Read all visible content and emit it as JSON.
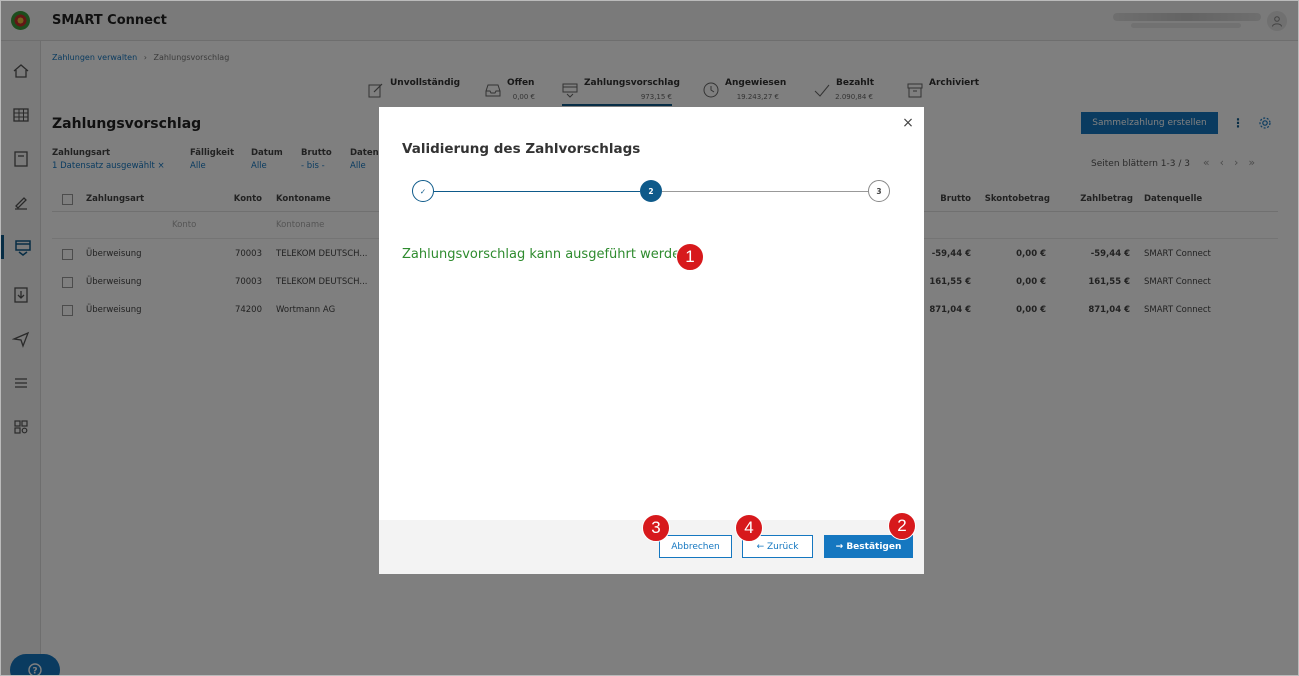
{
  "app": {
    "title": "SMART Connect"
  },
  "breadcrumb": {
    "root": "Zahlungen verwalten",
    "sep": "›",
    "current": "Zahlungsvorschlag"
  },
  "status_tabs": [
    {
      "label": "Unvollständig",
      "amount": ""
    },
    {
      "label": "Offen",
      "amount": "0,00 €"
    },
    {
      "label": "Zahlungsvorschlag",
      "amount": "973,15 €"
    },
    {
      "label": "Angewiesen",
      "amount": "19.243,27 €"
    },
    {
      "label": "Bezahlt",
      "amount": "2.090,84 €"
    },
    {
      "label": "Archiviert",
      "amount": ""
    }
  ],
  "page": {
    "title": "Zahlungsvorschlag",
    "primary_button": "Sammelzahlung erstellen",
    "paging_label": "Seiten blättern 1-3 / 3"
  },
  "filters": [
    {
      "label": "Zahlungsart",
      "value": "1 Datensatz ausgewählt ×"
    },
    {
      "label": "Fälligkeit",
      "value": "Alle"
    },
    {
      "label": "Datum",
      "value": "Alle"
    },
    {
      "label": "Brutto",
      "value": "- bis -"
    },
    {
      "label": "Datenq",
      "value": "Alle"
    }
  ],
  "table": {
    "headers": {
      "type": "Zahlungsart",
      "account": "Konto",
      "account_name": "Kontoname",
      "gross": "Brutto",
      "discount": "Skontobetrag",
      "payment": "Zahlbetrag",
      "source": "Datenquelle"
    },
    "filter_placeholders": {
      "account": "Konto",
      "account_name": "Kontoname"
    },
    "rows": [
      {
        "type": "Überweisung",
        "account": "70003",
        "account_name": "TELEKOM DEUTSCH...",
        "gross": "-59,44 €",
        "discount": "0,00 €",
        "payment": "-59,44 €",
        "source": "SMART Connect"
      },
      {
        "type": "Überweisung",
        "account": "70003",
        "account_name": "TELEKOM DEUTSCH...",
        "gross": "161,55 €",
        "discount": "0,00 €",
        "payment": "161,55 €",
        "source": "SMART Connect"
      },
      {
        "type": "Überweisung",
        "account": "74200",
        "account_name": "Wortmann AG",
        "gross": "871,04 €",
        "discount": "0,00 €",
        "payment": "871,04 €",
        "source": "SMART Connect"
      }
    ]
  },
  "dialog": {
    "title": "Validierung des Zahlvorschlags",
    "steps": {
      "step1": "✓",
      "step2": "2",
      "step3": "3"
    },
    "message": "Zahlungsvorschlag kann ausgeführt werden",
    "buttons": {
      "cancel": "Abbrechen",
      "back": "← Zurück",
      "confirm": "→ Bestätigen"
    },
    "close_glyph": "×"
  },
  "markers": {
    "m1": "1",
    "m2": "2",
    "m3": "3",
    "m4": "4"
  },
  "colors": {
    "primary": "#1577c0",
    "dark_primary": "#0e5a8a",
    "success": "#2e8b2e",
    "marker": "#d7191c"
  }
}
